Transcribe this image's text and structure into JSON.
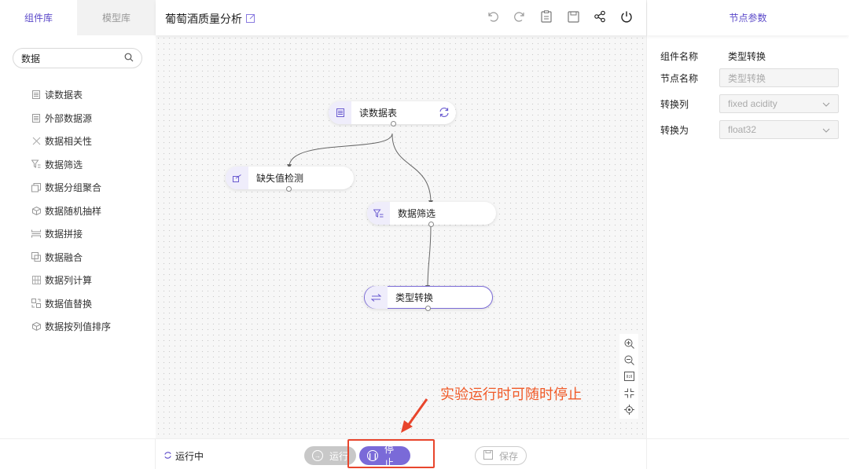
{
  "left_panel": {
    "tabs": [
      {
        "label": "组件库"
      },
      {
        "label": "模型库"
      }
    ],
    "search": {
      "value": "数据"
    },
    "components": [
      {
        "label": "读数据表",
        "icon": "table-icon"
      },
      {
        "label": "外部数据源",
        "icon": "table-icon"
      },
      {
        "label": "数据相关性",
        "icon": "scatter-icon"
      },
      {
        "label": "数据筛选",
        "icon": "filter-icon"
      },
      {
        "label": "数据分组聚合",
        "icon": "group-icon"
      },
      {
        "label": "数据随机抽样",
        "icon": "cube-icon"
      },
      {
        "label": "数据拼接",
        "icon": "concat-icon"
      },
      {
        "label": "数据融合",
        "icon": "merge-icon"
      },
      {
        "label": "数据列计算",
        "icon": "grid-icon"
      },
      {
        "label": "数据值替换",
        "icon": "replace-icon"
      },
      {
        "label": "数据按列值排序",
        "icon": "cube-icon"
      }
    ]
  },
  "header": {
    "title": "葡萄酒质量分析",
    "toolbar": [
      "undo-icon",
      "redo-icon",
      "clipboard-icon",
      "save-icon",
      "share-icon",
      "power-icon"
    ]
  },
  "canvas": {
    "nodes": [
      {
        "id": "n1",
        "label": "读数据表",
        "icon": "table-icon"
      },
      {
        "id": "n2",
        "label": "缺失值检测",
        "icon": "check-icon"
      },
      {
        "id": "n3",
        "label": "数据筛选",
        "icon": "filter-icon"
      },
      {
        "id": "n4",
        "label": "类型转换",
        "icon": "swap-icon"
      }
    ],
    "annotation": "实验运行时可随时停止"
  },
  "right_panel": {
    "title": "节点参数",
    "component_name_label": "组件名称",
    "component_name_value": "类型转换",
    "node_name_label": "节点名称",
    "node_name_placeholder": "类型转换",
    "convert_col_label": "转换列",
    "convert_col_value": "fixed acidity",
    "convert_to_label": "转换为",
    "convert_to_value": "float32"
  },
  "bottom": {
    "status": "运行中",
    "run_label": "运行",
    "stop_label": "停止",
    "save_label": "保存"
  },
  "colors": {
    "accent": "#5b49c9",
    "stop_button": "#7a6ad8",
    "annotation": "#f05a28",
    "highlight": "#e8452c"
  }
}
